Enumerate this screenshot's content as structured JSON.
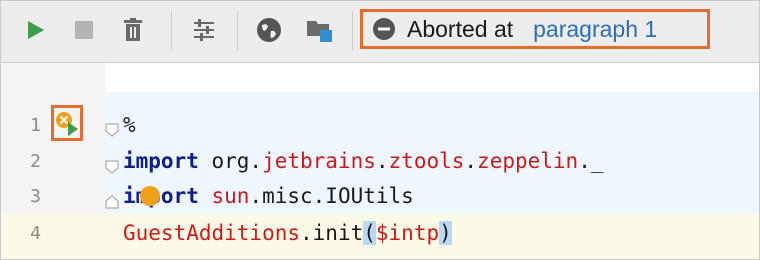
{
  "toolbar": {
    "icons": [
      "run-icon",
      "stop-icon",
      "delete-icon",
      "settings-sliders-icon",
      "globe-icon",
      "folder-icon"
    ],
    "status": {
      "icon": "abort-icon",
      "text": "Aborted at",
      "link": "paragraph 1"
    },
    "colors": {
      "run": "#3f9c4a",
      "accent_border": "#e46c2c",
      "link": "#2c6fb5"
    }
  },
  "editor": {
    "lines": [
      {
        "number": "1",
        "tokens": [
          {
            "text": "%",
            "cls": ""
          }
        ]
      },
      {
        "number": "2",
        "tokens": [
          {
            "text": "import",
            "cls": "kw"
          },
          {
            "text": " org.",
            "cls": ""
          },
          {
            "text": "jetbrains",
            "cls": "red"
          },
          {
            "text": ".",
            "cls": ""
          },
          {
            "text": "ztools",
            "cls": "red"
          },
          {
            "text": ".",
            "cls": ""
          },
          {
            "text": "zeppelin",
            "cls": "red"
          },
          {
            "text": "._",
            "cls": ""
          }
        ]
      },
      {
        "number": "3",
        "tokens": [
          {
            "text": "import",
            "cls": "kw"
          },
          {
            "text": " ",
            "cls": ""
          },
          {
            "text": "sun",
            "cls": "red"
          },
          {
            "text": ".misc.IOUtils",
            "cls": ""
          }
        ]
      },
      {
        "number": "4",
        "tokens": [
          {
            "text": "GuestAdditions",
            "cls": "red"
          },
          {
            "text": ".init",
            "cls": ""
          },
          {
            "text": "(",
            "cls": "hl"
          },
          {
            "text": "$intp",
            "cls": "red"
          },
          {
            "text": ")",
            "cls": "hl"
          }
        ]
      }
    ],
    "gutter_marker_icon": "error-run-icon"
  }
}
